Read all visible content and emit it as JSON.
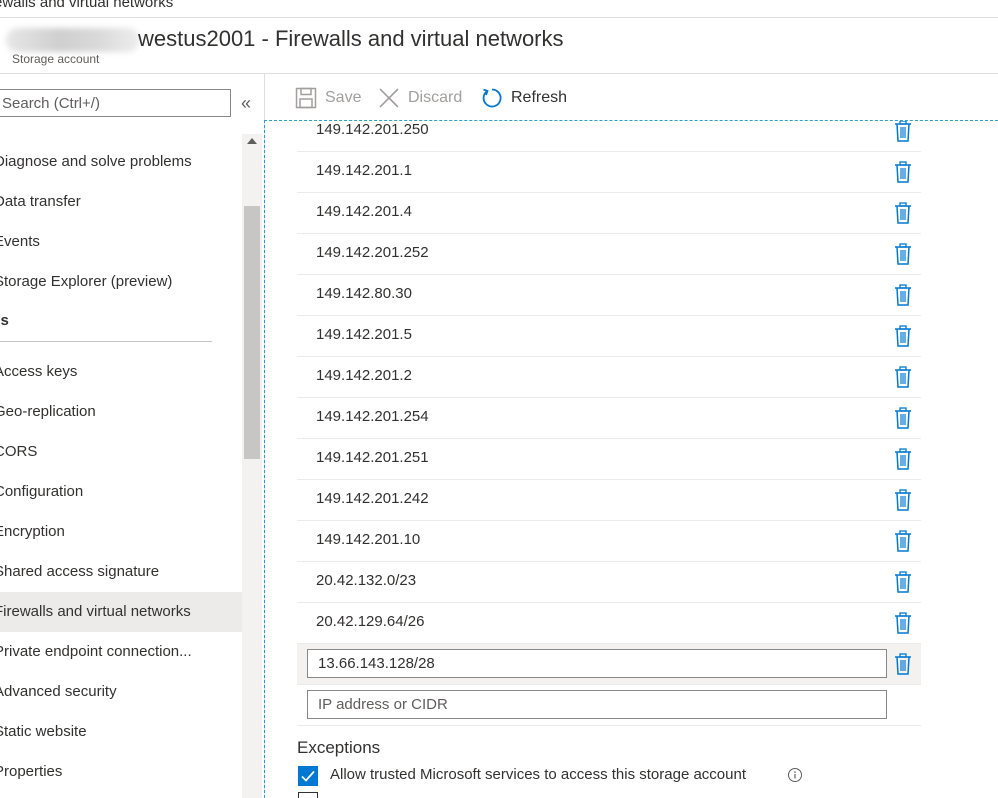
{
  "breadcrumb": {
    "text": "ewalls and virtual networks"
  },
  "header": {
    "title": "westus2001 - Firewalls and virtual networks",
    "subtitle": "Storage account"
  },
  "sidebar": {
    "search_placeholder": "Search (Ctrl+/)",
    "collapse_glyph": "«",
    "items": [
      {
        "label": "Diagnose and solve problems"
      },
      {
        "label": "Data transfer"
      },
      {
        "label": "Events"
      },
      {
        "label": "Storage Explorer (preview)"
      }
    ],
    "section_label": "ings",
    "settings_items": [
      {
        "label": "Access keys"
      },
      {
        "label": "Geo-replication"
      },
      {
        "label": "CORS"
      },
      {
        "label": "Configuration"
      },
      {
        "label": "Encryption"
      },
      {
        "label": "Shared access signature"
      },
      {
        "label": "Firewalls and virtual networks",
        "active": true
      },
      {
        "label": "Private endpoint connection..."
      },
      {
        "label": "Advanced security"
      },
      {
        "label": "Static website"
      },
      {
        "label": "Properties"
      }
    ]
  },
  "toolbar": {
    "save_label": "Save",
    "discard_label": "Discard",
    "refresh_label": "Refresh"
  },
  "firewall": {
    "ip_ranges": [
      "149.142.201.250",
      "149.142.201.1",
      "149.142.201.4",
      "149.142.201.252",
      "149.142.80.30",
      "149.142.201.5",
      "149.142.201.2",
      "149.142.201.254",
      "149.142.201.251",
      "149.142.201.242",
      "149.142.201.10",
      "20.42.132.0/23",
      "20.42.129.64/26"
    ],
    "editing_value": "13.66.143.128/28",
    "new_placeholder": "IP address or CIDR"
  },
  "exceptions": {
    "title": "Exceptions",
    "allow_trusted_label": "Allow trusted Microsoft services to access this storage account",
    "allow_trusted_checked": true
  },
  "colors": {
    "accent": "#0078d4",
    "active_nav_bg": "#edebe9",
    "disabled_text": "#a19f9d"
  }
}
